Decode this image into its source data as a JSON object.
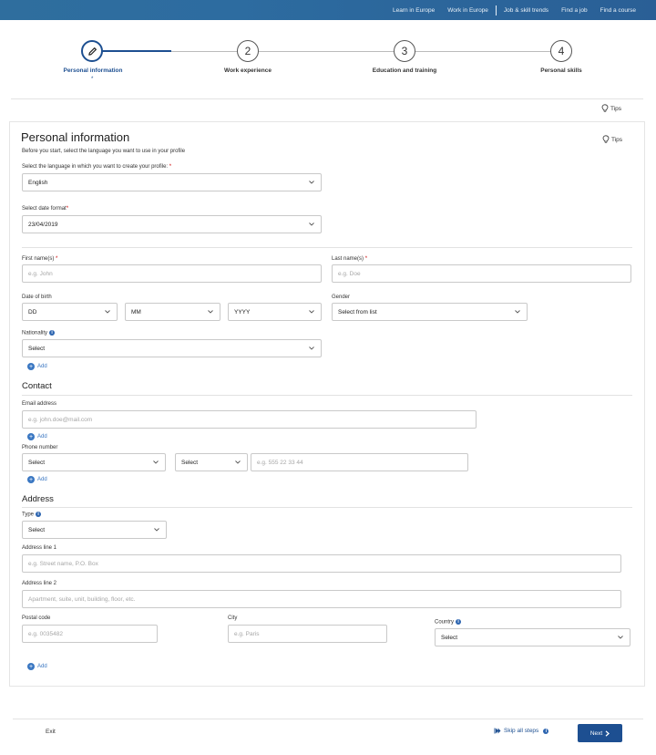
{
  "topnav": [
    "Learn in Europe",
    "Work in Europe",
    "Job & skill trends",
    "Find a job",
    "Find a course"
  ],
  "steps": [
    {
      "number": "",
      "label": "Personal information",
      "marker": "*"
    },
    {
      "number": "2",
      "label": "Work experience"
    },
    {
      "number": "3",
      "label": "Education and training"
    },
    {
      "number": "4",
      "label": "Personal skills"
    }
  ],
  "tips_label": "Tips",
  "section": {
    "title": "Personal information",
    "intro": "Before you start, select the language you want to use in your profile",
    "language_label": "Select the language in which you want to create your profile:",
    "language_value": "English",
    "date_format_label": "Select date format",
    "date_format_value": "23/04/2019"
  },
  "required_marker": "*",
  "person": {
    "first_name_label": "First name(s)",
    "first_name_placeholder": "e.g. John",
    "last_name_label": "Last name(s)",
    "last_name_placeholder": "e.g. Doe",
    "dob_label": "Date of birth",
    "dob_day": "DD",
    "dob_month": "MM",
    "dob_year": "YYYY",
    "gender_label": "Gender",
    "gender_value": "Select from list",
    "nationality_label": "Nationality",
    "nationality_value": "Select",
    "add_label": "Add"
  },
  "contact": {
    "title": "Contact",
    "email_label": "Email address",
    "email_placeholder": "e.g. john.doe@mail.com",
    "phone_label": "Phone number",
    "phone_type_value": "Select",
    "phone_prefix_value": "Select",
    "phone_placeholder": "e.g. 555 22 33 44"
  },
  "address": {
    "title": "Address",
    "type_label": "Type",
    "type_value": "Select",
    "line1_label": "Address line 1",
    "line1_placeholder": "e.g. Street name, P.O. Box",
    "line2_label": "Address line 2",
    "line2_placeholder": "Apartment, suite, unit, building, floor, etc.",
    "postal_label": "Postal code",
    "postal_placeholder": "e.g. 0035482",
    "city_label": "City",
    "city_placeholder": "e.g. Paris",
    "country_label": "Country",
    "country_value": "Select"
  },
  "footer": {
    "exit_label": "Exit",
    "skip_label": "Skip all steps",
    "next_label": "Next"
  },
  "colors": {
    "primary": "#1d4f91",
    "link": "#3a77c2",
    "header": "#2d6ca0",
    "required": "#cc0000"
  }
}
